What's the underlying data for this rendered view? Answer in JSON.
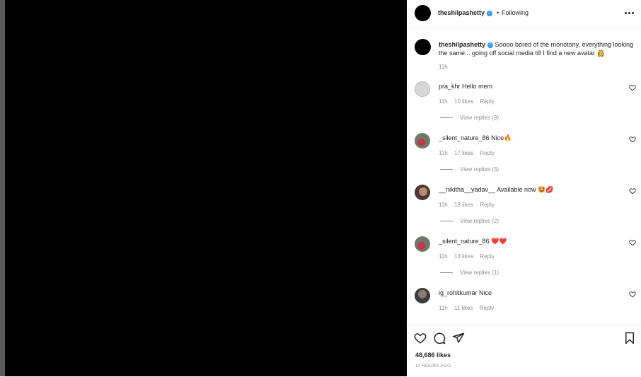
{
  "post": {
    "username": "theshilpashetty",
    "separator": "•",
    "follow_status": "Following",
    "caption": "Soooo bored of the monotony, everything looking the same... going off social media till I find a new avatar 👸",
    "caption_time": "11h",
    "likes": "48,686 likes",
    "posted_ago": "11 HOURS AGO"
  },
  "comments": [
    {
      "user": "pra_khr",
      "text": "Hello mem",
      "time": "11h",
      "likes": "10 likes",
      "reply": "Reply",
      "view_replies": "View replies (9)"
    },
    {
      "user": "_silent_nature_86",
      "text": "Nice🔥",
      "time": "11h",
      "likes": "17 likes",
      "reply": "Reply",
      "view_replies": "View replies (3)"
    },
    {
      "user": "__nikitha__yadav__",
      "text": "Available now 🤩💋",
      "time": "11h",
      "likes": "18 likes",
      "reply": "Reply",
      "view_replies": "View replies (2)"
    },
    {
      "user": "_silent_nature_86",
      "text": "❤️❤️",
      "time": "11h",
      "likes": "13 likes",
      "reply": "Reply",
      "view_replies": "View replies (1)"
    },
    {
      "user": "ig_rohitkumar",
      "text": "Nice",
      "time": "11h",
      "likes": "11 likes",
      "reply": "Reply"
    }
  ],
  "icons": {
    "verified": "verified-badge-icon",
    "more": "more-options-icon",
    "like": "heart-icon",
    "comment": "comment-icon",
    "share": "share-icon",
    "save": "bookmark-icon"
  },
  "colors": {
    "verified": "#3897f0",
    "muted_text": "#8e8e8e",
    "text": "#262626"
  }
}
